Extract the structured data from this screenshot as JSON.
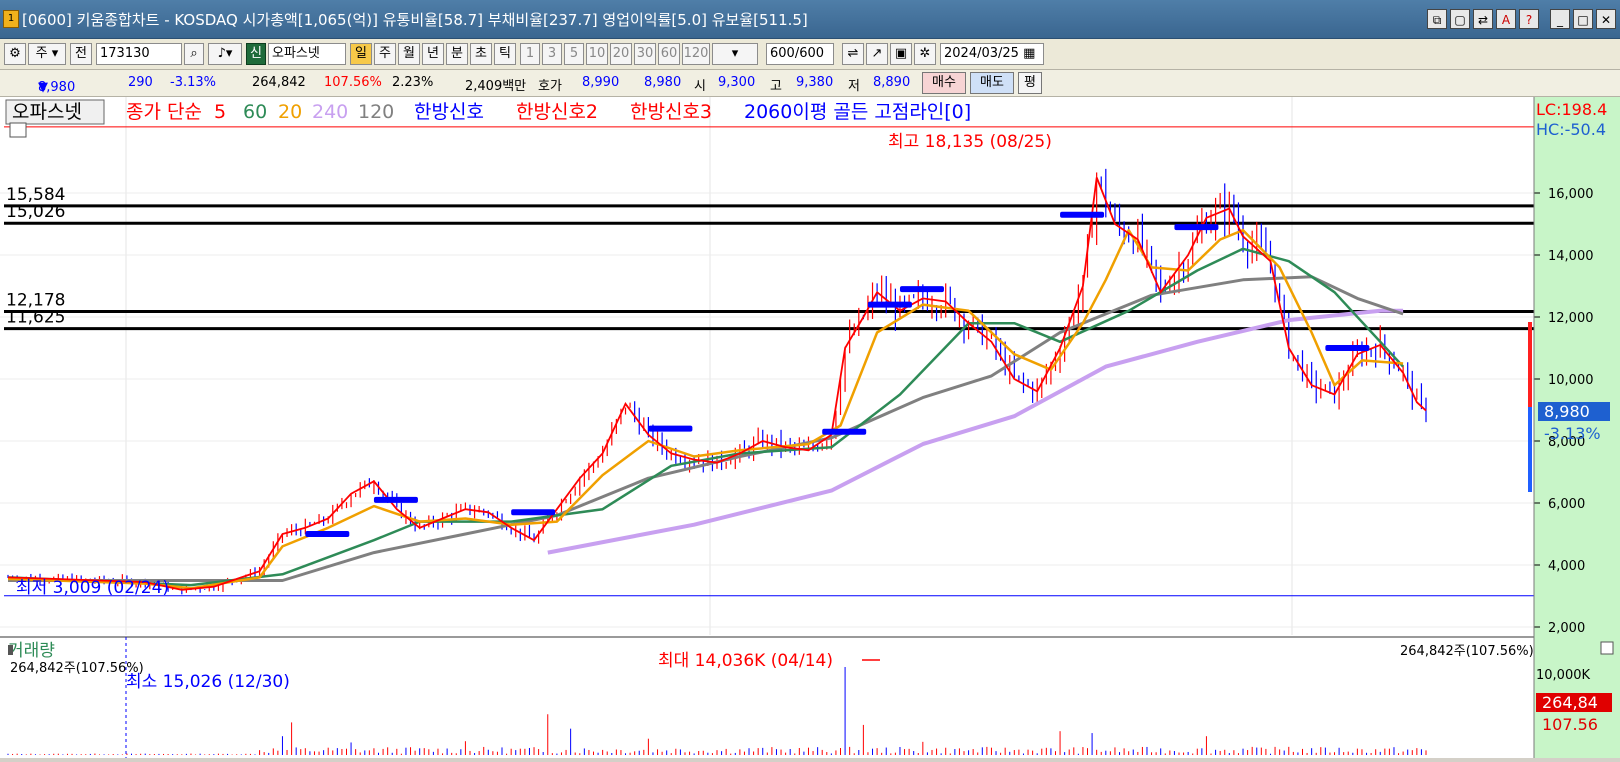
{
  "window": {
    "title": "[0600] 키움종합차트 - KOSDAQ 시가총액[1,065(억)] 유통비율[58.7] 부채비율[237.7] 영업이익률[5.0] 유보율[511.5]",
    "buttons": [
      "⧉",
      "▢",
      "⇄",
      "A",
      "?",
      "_",
      "□",
      "✕"
    ]
  },
  "toolbar": {
    "period_label": "주",
    "prev_label": "전",
    "code_value": "173130",
    "market_badge": "신",
    "stock_name": "오파스넷",
    "intervals": [
      "일",
      "주",
      "월",
      "년",
      "분",
      "초",
      "틱"
    ],
    "selected_interval": "일",
    "minute_presets": [
      "1",
      "3",
      "5",
      "10",
      "20",
      "30",
      "60",
      "120"
    ],
    "count_value": "600",
    "count_total": "/600",
    "date_value": "2024/03/25"
  },
  "info": {
    "price": "8,980",
    "change_arrow": "▼",
    "change": "290",
    "change_pct": "-3.13%",
    "volume": "264,842",
    "volume_ratio": "107.56%",
    "turnover": "2.23%",
    "amount": "2,409백만",
    "quote_label": "호가",
    "ask": "8,990",
    "bid": "8,980",
    "open_label": "시",
    "open": "9,300",
    "high_label": "고",
    "high": "9,380",
    "low_label": "저",
    "low": "8,890",
    "buy_label": "매수",
    "sell_label": "매도",
    "eval_label": "평"
  },
  "legend": {
    "stock": "오파스넷",
    "ma_prefix": "종가 단순",
    "ma_periods": [
      "5",
      "60",
      "20",
      "240",
      "120"
    ],
    "signal1": "한방신호",
    "signal2": "한방신호2",
    "signal3": "한방신호3",
    "signal4": "2060이평 골든 고점라인[0]"
  },
  "colors": {
    "candle": "#ff0000",
    "candle_down": "#0000ff",
    "ma5": "#ff0000",
    "ma20": "#f0a000",
    "ma60": "#2e8b57",
    "ma120": "#808080",
    "ma240": "#c8a0f0",
    "signal_bar": "#0000ff",
    "y_axis_bg": "#c8f5c8"
  },
  "chart_data": [
    {
      "type": "candlestick",
      "title": "",
      "ylim": [
        2000,
        18500
      ],
      "yticks": [
        "2,000",
        "4,000",
        "6,000",
        "8,000",
        "10,000",
        "12,000",
        "14,000",
        "16,000"
      ],
      "annotations": {
        "high": "최고 18,135 (08/25)",
        "low": "최저 3,009 (02/24)",
        "lc": "LC:198.4",
        "hc": "HC:-50.4",
        "current_price": "8,980",
        "current_change": "-3.13%"
      },
      "hlines": [
        {
          "label": "15,584",
          "value": 15584,
          "color": "#000000"
        },
        {
          "label": "15,026",
          "value": 15026,
          "color": "#000000"
        },
        {
          "label": "12,178",
          "value": 12178,
          "color": "#000000"
        },
        {
          "label": "11,625",
          "value": 11625,
          "color": "#000000"
        },
        {
          "label": "",
          "value": 18135,
          "color": "#ff0000"
        },
        {
          "label": "",
          "value": 3009,
          "color": "#0000ff"
        }
      ],
      "close_series": [
        [
          0,
          3600
        ],
        [
          10,
          3550
        ],
        [
          20,
          3500
        ],
        [
          30,
          3450
        ],
        [
          38,
          3200
        ],
        [
          45,
          3300
        ],
        [
          55,
          3800
        ],
        [
          60,
          5000
        ],
        [
          65,
          5200
        ],
        [
          70,
          5500
        ],
        [
          75,
          6300
        ],
        [
          80,
          6700
        ],
        [
          85,
          5800
        ],
        [
          90,
          5200
        ],
        [
          95,
          5500
        ],
        [
          100,
          5800
        ],
        [
          105,
          5700
        ],
        [
          110,
          5200
        ],
        [
          115,
          4800
        ],
        [
          120,
          5800
        ],
        [
          125,
          6800
        ],
        [
          130,
          7600
        ],
        [
          135,
          9200
        ],
        [
          140,
          8200
        ],
        [
          145,
          7600
        ],
        [
          150,
          7400
        ],
        [
          155,
          7300
        ],
        [
          160,
          7600
        ],
        [
          165,
          8000
        ],
        [
          170,
          7800
        ],
        [
          175,
          7700
        ],
        [
          180,
          8200
        ],
        [
          183,
          11000
        ],
        [
          187,
          12000
        ],
        [
          190,
          12800
        ],
        [
          195,
          12200
        ],
        [
          200,
          12600
        ],
        [
          205,
          12500
        ],
        [
          210,
          11800
        ],
        [
          215,
          11200
        ],
        [
          220,
          10000
        ],
        [
          225,
          9600
        ],
        [
          230,
          11000
        ],
        [
          235,
          13000
        ],
        [
          238,
          16500
        ],
        [
          242,
          15000
        ],
        [
          247,
          14500
        ],
        [
          252,
          12800
        ],
        [
          258,
          14000
        ],
        [
          262,
          15200
        ],
        [
          267,
          15500
        ],
        [
          270,
          14600
        ],
        [
          276,
          13800
        ],
        [
          280,
          11000
        ],
        [
          285,
          9800
        ],
        [
          290,
          9500
        ],
        [
          295,
          10800
        ],
        [
          300,
          11100
        ],
        [
          305,
          10200
        ],
        [
          308,
          9250
        ],
        [
          310,
          8980
        ]
      ],
      "ma_series": {
        "ma20": [
          [
            0,
            3550
          ],
          [
            30,
            3400
          ],
          [
            40,
            3250
          ],
          [
            55,
            3600
          ],
          [
            60,
            4600
          ],
          [
            70,
            5200
          ],
          [
            80,
            5900
          ],
          [
            90,
            5400
          ],
          [
            100,
            5500
          ],
          [
            110,
            5300
          ],
          [
            120,
            5400
          ],
          [
            130,
            6900
          ],
          [
            140,
            8000
          ],
          [
            150,
            7500
          ],
          [
            160,
            7700
          ],
          [
            175,
            7900
          ],
          [
            182,
            8500
          ],
          [
            190,
            11500
          ],
          [
            200,
            12400
          ],
          [
            210,
            12200
          ],
          [
            220,
            10800
          ],
          [
            228,
            10300
          ],
          [
            235,
            11800
          ],
          [
            240,
            13200
          ],
          [
            245,
            14800
          ],
          [
            250,
            13600
          ],
          [
            258,
            13500
          ],
          [
            265,
            14500
          ],
          [
            270,
            14800
          ],
          [
            278,
            13600
          ],
          [
            285,
            11500
          ],
          [
            290,
            9800
          ],
          [
            296,
            10600
          ],
          [
            305,
            10500
          ]
        ],
        "ma60": [
          [
            0,
            3600
          ],
          [
            40,
            3350
          ],
          [
            60,
            3700
          ],
          [
            80,
            4800
          ],
          [
            90,
            5400
          ],
          [
            110,
            5400
          ],
          [
            130,
            5800
          ],
          [
            145,
            7200
          ],
          [
            160,
            7600
          ],
          [
            180,
            7800
          ],
          [
            195,
            9500
          ],
          [
            210,
            11800
          ],
          [
            220,
            11800
          ],
          [
            230,
            11200
          ],
          [
            245,
            12200
          ],
          [
            260,
            13500
          ],
          [
            270,
            14200
          ],
          [
            280,
            13800
          ],
          [
            290,
            12800
          ],
          [
            300,
            11200
          ],
          [
            305,
            10400
          ]
        ],
        "ma120": [
          [
            0,
            3500
          ],
          [
            60,
            3500
          ],
          [
            80,
            4400
          ],
          [
            100,
            5000
          ],
          [
            120,
            5600
          ],
          [
            140,
            6800
          ],
          [
            160,
            7500
          ],
          [
            180,
            8100
          ],
          [
            200,
            9400
          ],
          [
            215,
            10100
          ],
          [
            230,
            11500
          ],
          [
            250,
            12700
          ],
          [
            270,
            13200
          ],
          [
            285,
            13300
          ],
          [
            295,
            12600
          ],
          [
            305,
            12100
          ]
        ],
        "ma240": [
          [
            118,
            4400
          ],
          [
            150,
            5300
          ],
          [
            180,
            6400
          ],
          [
            200,
            7900
          ],
          [
            220,
            8800
          ],
          [
            240,
            10400
          ],
          [
            260,
            11200
          ],
          [
            280,
            11900
          ],
          [
            300,
            12200
          ],
          [
            305,
            12200
          ]
        ]
      },
      "signal_bars": [
        [
          65,
          5000
        ],
        [
          80,
          6100
        ],
        [
          110,
          5700
        ],
        [
          140,
          8400
        ],
        [
          178,
          8300
        ],
        [
          188,
          12400
        ],
        [
          195,
          12900
        ],
        [
          230,
          15300
        ],
        [
          255,
          14900
        ],
        [
          288,
          11000
        ]
      ]
    },
    {
      "type": "bar",
      "title": "거래량",
      "current_volume_label": "264,842주(107.56%)",
      "right_label": "264,842주(107.56%)",
      "max_label": "최대 14,036K (04/14)",
      "min_label": "최소 15,026 (12/30)",
      "yticks": [
        "10,000K"
      ],
      "axis_value": "264,84",
      "axis_pct": "107.56",
      "spikes": [
        [
          60,
          3000
        ],
        [
          62,
          5200
        ],
        [
          75,
          2000
        ],
        [
          100,
          2200
        ],
        [
          118,
          6500
        ],
        [
          123,
          4200
        ],
        [
          140,
          2600
        ],
        [
          183,
          14036
        ],
        [
          187,
          4800
        ],
        [
          200,
          2100
        ],
        [
          230,
          3800
        ],
        [
          237,
          3500
        ],
        [
          262,
          3000
        ],
        [
          280,
          1300
        ]
      ]
    }
  ]
}
